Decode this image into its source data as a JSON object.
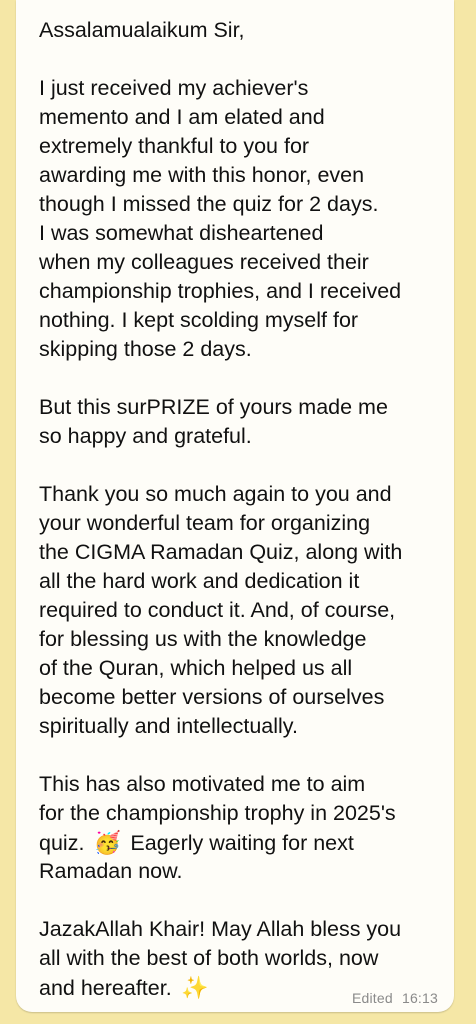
{
  "message": {
    "lines": [
      "Assalamualaikum Sir,",
      "",
      "I just received my achiever's",
      "memento and I am elated and",
      "extremely thankful to you for",
      "awarding me with this honor, even",
      "though I missed the quiz for 2 days.",
      "I was somewhat disheartened",
      "when my colleagues received their",
      "championship trophies, and I received",
      "nothing. I kept scolding myself for",
      "skipping those 2 days.",
      "",
      "But this surPRIZE of yours made me",
      "so happy and grateful.",
      "",
      "Thank you so much again to you and",
      "your wonderful team for organizing",
      "the CIGMA Ramadan Quiz, along with",
      "all the hard work and dedication it",
      "required to conduct it. And, of course,",
      "for blessing us with the knowledge",
      "of the Quran, which helped us all",
      "become better versions of ourselves",
      "spiritually and intellectually.",
      "",
      "This  has also motivated me to aim",
      "for the championship trophy in 2025's"
    ],
    "quiz_text": "quiz.",
    "party_emoji": "🥳",
    "waiting_text": "Eagerly waiting for next",
    "lines_after": [
      "Ramadan now.",
      "",
      "JazakAllah Khair! May Allah bless you",
      "all with the best of both worlds, now"
    ],
    "hereafter_text": "and hereafter.",
    "sparkles_emoji": "✨",
    "edited_label": "Edited",
    "time": "16:13"
  }
}
